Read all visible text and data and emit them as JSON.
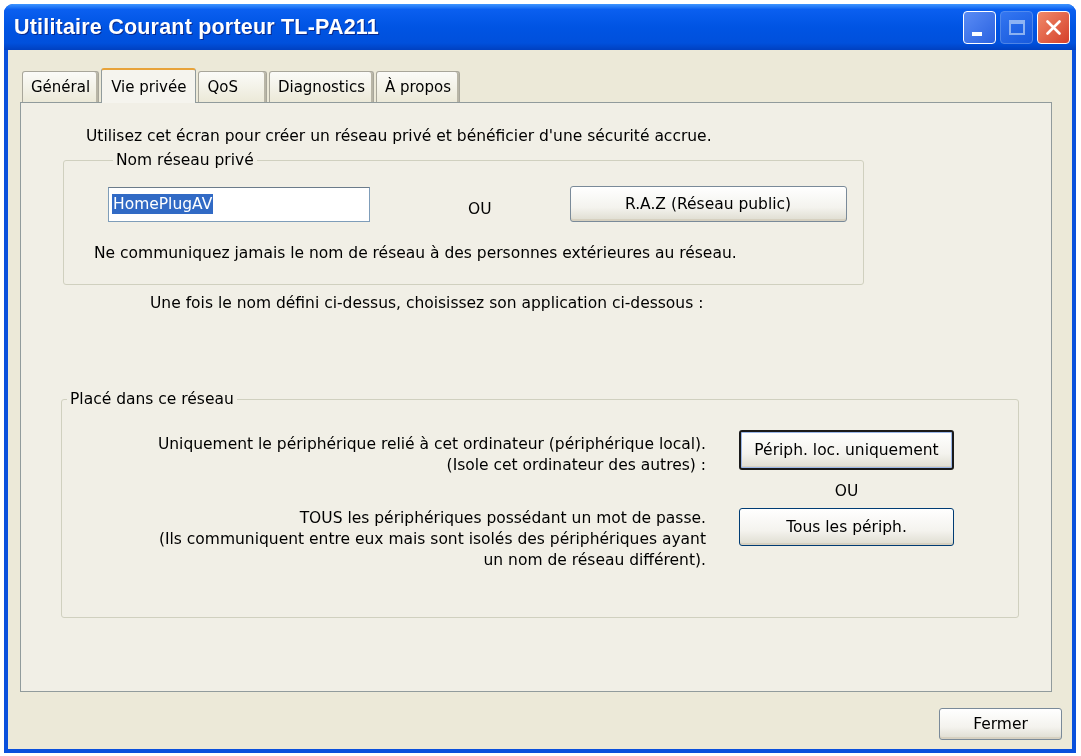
{
  "window": {
    "title": "Utilitaire Courant porteur TL-PA211",
    "title_buttons": [
      {
        "kind": "minimize",
        "disabled": false
      },
      {
        "kind": "maximize",
        "disabled": true
      },
      {
        "kind": "close",
        "disabled": false
      }
    ]
  },
  "tabs": [
    {
      "label": "Général",
      "selected": false
    },
    {
      "label": "Vie privée",
      "selected": true
    },
    {
      "label": "QoS",
      "selected": false
    },
    {
      "label": "Diagnostics",
      "selected": false
    },
    {
      "label": "À propos",
      "selected": false
    }
  ],
  "intro": "Utilisez cet écran pour créer un réseau privé et bénéficier d'une sécurité accrue.",
  "private_name_group": {
    "legend": "Nom réseau privé",
    "field": {
      "value": "HomePlugAV",
      "value_selected": true
    },
    "or_label": "OU",
    "reset_button": {
      "label": "R.A.Z (Réseau public)",
      "default": false
    },
    "warning": "Ne communiquez jamais le nom de réseau à des personnes extérieures au réseau."
  },
  "instruction": "Une fois le nom défini ci-dessus, choisissez son application ci-dessous :",
  "placement_group": {
    "legend": "Placé dans ce réseau",
    "options": [
      {
        "description": "Uniquement le périphérique relié à cet ordinateur (périphérique local).\n(Isole cet ordinateur des autres) :",
        "button": {
          "label": "Périph. loc. uniquement",
          "default": true
        }
      },
      {
        "description": "TOUS les périphériques possédant un mot de passe.\n(Ils communiquent entre eux mais sont isolés des périphériques ayant\nun nom de réseau différent).",
        "button": {
          "label": "Tous les périph.",
          "default": false
        }
      }
    ],
    "or_label": "OU"
  },
  "footer_buttons": [
    {
      "label": "Fermer",
      "default": false
    }
  ]
}
